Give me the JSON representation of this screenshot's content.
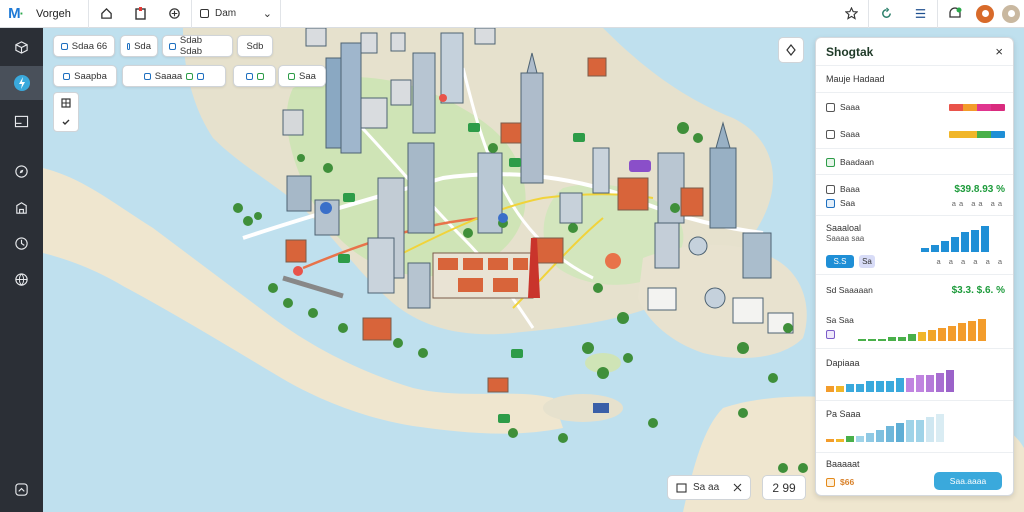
{
  "app": {
    "name": "Vorgeh"
  },
  "toolbar": {
    "select_value": "Dam",
    "chevron": "⌄"
  },
  "chips": [
    {
      "label": "Sdaa 66"
    },
    {
      "label": "Sda"
    },
    {
      "label": "Sdab Sdab"
    },
    {
      "label": "Sdb"
    },
    {
      "label": "Saapba"
    },
    {
      "label": "Saaaa"
    },
    {
      "label": ""
    },
    {
      "label": ""
    },
    {
      "label": "Saa"
    }
  ],
  "bottom": {
    "scale_text": "Sa aa",
    "zoom_text": "2 99"
  },
  "panel": {
    "title": "Shogtak",
    "close": "×",
    "subheader": "Mauje Hadaad",
    "legend_rows": [
      {
        "label": "Saaa",
        "colors": [
          "#e9534a",
          "#f39c2b",
          "#e0358f",
          "#d92b7e"
        ]
      },
      {
        "label": "Saaa",
        "colors": [
          "#f1b629",
          "#f1b629",
          "#49b04a",
          "#1f8fd6"
        ]
      }
    ],
    "section1_title": "Baadaan",
    "metric1": {
      "label": "Baaa",
      "value": "$39.8.93 %"
    },
    "metric1_sub": {
      "label": "Saa",
      "dots": "aa aa aa"
    },
    "section2_title": "Saaaloal",
    "section2_sub": "Saaaa saa",
    "btn_primary": "S.S",
    "btn_secondary": "Sa",
    "bars2_ticks": "a a a a a a",
    "section3": {
      "label": "Sd Saaaaan",
      "value": "$3.3. $.6. %"
    },
    "section3_sub": "Sa Saa",
    "section4_title": "Dapiaaa",
    "section5_title": "Pa Saaa",
    "section6_title": "Baaaaat",
    "footer_value": "$66",
    "apply_btn": "Saa.aaaa"
  },
  "colors": {
    "water": "#bfe0ee",
    "land": "#e8e2cf",
    "park": "#cfe4b6",
    "accent": "#3aa9dc",
    "green": "#1d9b3b"
  },
  "icons": {
    "rail": [
      "cube-icon",
      "lightning-icon",
      "panel-icon",
      "compass-icon",
      "building-icon",
      "clock-icon",
      "globe-icon",
      "fullscreen-icon"
    ]
  },
  "chart_data": [
    {
      "type": "bar",
      "title": "Saaaloal",
      "values": [
        2,
        3,
        5,
        7,
        9,
        10,
        12
      ]
    },
    {
      "type": "bar",
      "title": "Sd Saaaaan",
      "values": [
        1,
        1,
        1,
        2,
        2,
        3,
        4,
        5,
        6,
        7,
        8,
        9,
        10
      ]
    },
    {
      "type": "bar",
      "title": "Dapiaaa",
      "values": [
        2,
        2,
        3,
        3,
        4,
        4,
        4,
        5,
        5,
        6,
        6,
        7,
        8
      ]
    },
    {
      "type": "bar",
      "title": "Pa Saaa",
      "values": [
        1,
        1,
        2,
        2,
        3,
        4,
        5,
        6,
        7,
        7,
        8,
        9
      ]
    }
  ]
}
